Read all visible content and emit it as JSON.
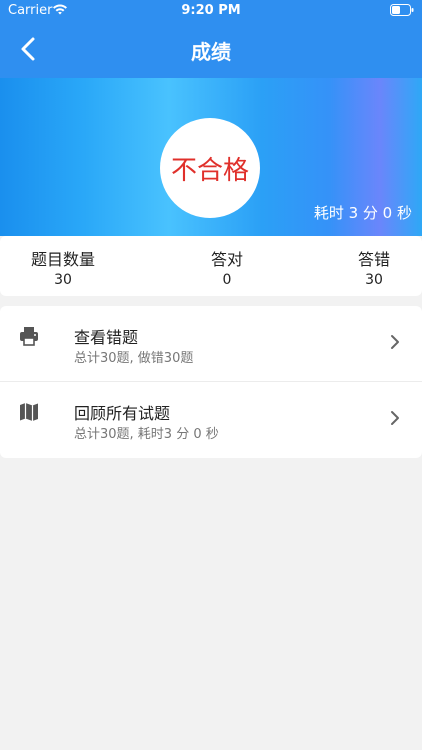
{
  "status": {
    "carrier": "Carrier",
    "time": "9:20 PM"
  },
  "nav": {
    "title": "成绩"
  },
  "result": {
    "verdict": "不合格",
    "elapsed": "耗时 3 分 0 秒"
  },
  "stats": [
    {
      "label": "题目数量",
      "value": "30"
    },
    {
      "label": "答对",
      "value": "0"
    },
    {
      "label": "答错",
      "value": "30"
    }
  ],
  "actions": [
    {
      "title": "查看错题",
      "subtitle": "总计30题, 做错30题",
      "icon": "printer-icon"
    },
    {
      "title": "回顾所有试题",
      "subtitle": "总计30题, 耗时3 分 0 秒",
      "icon": "map-icon"
    }
  ],
  "colors": {
    "header": "#2f8ff0",
    "verdict": "#e0302b"
  }
}
